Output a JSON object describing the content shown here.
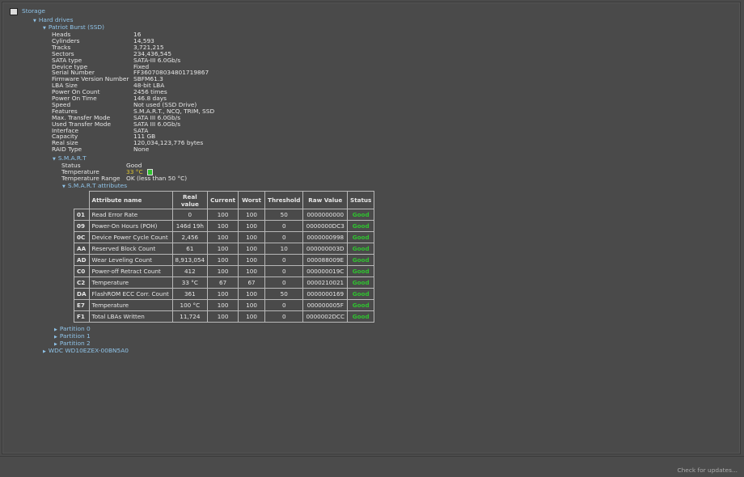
{
  "tree": {
    "storage": "Storage",
    "hard_drives": "Hard drives",
    "drive": "Patriot Burst (SSD)",
    "properties": [
      [
        "Heads",
        "16"
      ],
      [
        "Cylinders",
        "14,593"
      ],
      [
        "Tracks",
        "3,721,215"
      ],
      [
        "Sectors",
        "234,436,545"
      ],
      [
        "SATA type",
        "SATA-III 6.0Gb/s"
      ],
      [
        "Device type",
        "Fixed"
      ],
      [
        "Serial Number",
        "FF360708034801719867"
      ],
      [
        "Firmware Version Number",
        "SBFM61.3"
      ],
      [
        "LBA Size",
        "48-bit LBA"
      ],
      [
        "Power On Count",
        "2456 times"
      ],
      [
        "Power On Time",
        "146.8 days"
      ],
      [
        "Speed",
        "Not used (SSD Drive)"
      ],
      [
        "Features",
        "S.M.A.R.T., NCQ, TRIM, SSD"
      ],
      [
        "Max. Transfer Mode",
        "SATA III 6.0Gb/s"
      ],
      [
        "Used Transfer Mode",
        "SATA III 6.0Gb/s"
      ],
      [
        "Interface",
        "SATA"
      ],
      [
        "Capacity",
        "111 GB"
      ],
      [
        "Real size",
        "120,034,123,776 bytes"
      ],
      [
        "RAID Type",
        "None"
      ]
    ],
    "smart": {
      "label": "S.M.A.R.T",
      "status_label": "Status",
      "status": "Good",
      "temp_label": "Temperature",
      "temp": "33 °C",
      "range_label": "Temperature Range",
      "range": "OK (less than 50 °C)",
      "attributes_label": "S.M.A.R.T attributes"
    },
    "partitions": [
      "Partition 0",
      "Partition 1",
      "Partition 2"
    ],
    "other_drive": "WDC WD10EZEX-00BN5A0"
  },
  "table": {
    "headers": [
      "Attribute name",
      "Real value",
      "Current",
      "Worst",
      "Threshold",
      "Raw Value",
      "Status"
    ],
    "rows": [
      [
        "01",
        "Read Error Rate",
        "0",
        "100",
        "100",
        "50",
        "0000000000",
        "Good"
      ],
      [
        "09",
        "Power-On Hours (POH)",
        "146d 19h",
        "100",
        "100",
        "0",
        "0000000DC3",
        "Good"
      ],
      [
        "0C",
        "Device Power Cycle Count",
        "2,456",
        "100",
        "100",
        "0",
        "0000000998",
        "Good"
      ],
      [
        "AA",
        "Reserved Block Count",
        "61",
        "100",
        "100",
        "10",
        "000000003D",
        "Good"
      ],
      [
        "AD",
        "Wear Leveling Count",
        "8,913,054",
        "100",
        "100",
        "0",
        "000088009E",
        "Good"
      ],
      [
        "C0",
        "Power-off Retract Count",
        "412",
        "100",
        "100",
        "0",
        "000000019C",
        "Good"
      ],
      [
        "C2",
        "Temperature",
        "33 °C",
        "67",
        "67",
        "0",
        "0000210021",
        "Good"
      ],
      [
        "DA",
        "FlashROM ECC Corr. Count",
        "361",
        "100",
        "100",
        "50",
        "0000000169",
        "Good"
      ],
      [
        "E7",
        "Temperature",
        "100 °C",
        "100",
        "100",
        "0",
        "000000005F",
        "Good"
      ],
      [
        "F1",
        "Total LBAs Written",
        "11,724",
        "100",
        "100",
        "0",
        "0000002DCC",
        "Good"
      ]
    ]
  },
  "status_bar": {
    "check_updates": "Check for updates..."
  },
  "colors": {
    "good": "#2fc22f",
    "temp": "#d8c030",
    "link": "#8fc3e8"
  }
}
